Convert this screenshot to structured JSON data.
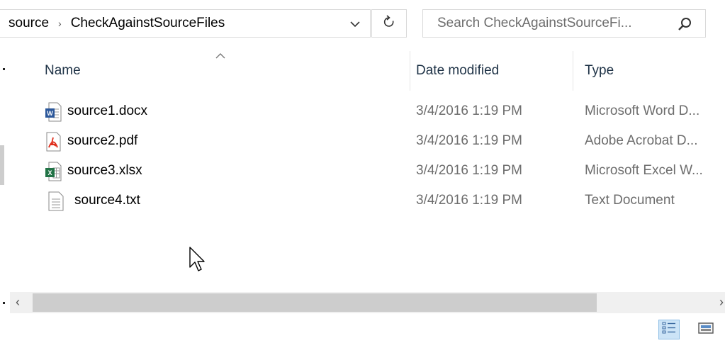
{
  "address_bar": {
    "crumbs": [
      "source",
      "CheckAgainstSourceFiles"
    ],
    "separator": "›",
    "dropdown_icon": "chevron-down-icon",
    "refresh_icon": "refresh-icon"
  },
  "search": {
    "placeholder": "Search CheckAgainstSourceFi...",
    "icon": "search-icon"
  },
  "columns": [
    {
      "label": "Name",
      "sorted": "ascending"
    },
    {
      "label": "Date modified"
    },
    {
      "label": "Type"
    }
  ],
  "files": [
    {
      "name": "source1.docx",
      "date": "3/4/2016 1:19 PM",
      "type": "Microsoft Word D...",
      "icon": "word-document-icon"
    },
    {
      "name": "source2.pdf",
      "date": "3/4/2016 1:19 PM",
      "type": "Adobe Acrobat D...",
      "icon": "pdf-document-icon"
    },
    {
      "name": "source3.xlsx",
      "date": "3/4/2016 1:19 PM",
      "type": "Microsoft Excel W...",
      "icon": "excel-document-icon"
    },
    {
      "name": "source4.txt",
      "date": "3/4/2016 1:19 PM",
      "type": "Text Document",
      "icon": "text-document-icon"
    }
  ],
  "scrollbar": {
    "left_arrow": "‹",
    "right_arrow": "›"
  },
  "view_modes": [
    {
      "icon": "details-view-icon",
      "active": true
    },
    {
      "icon": "large-icons-view-icon",
      "active": false
    }
  ],
  "colors": {
    "header_text": "#1e3246",
    "secondary_text": "#6d6d6d",
    "border": "#d9d9d9",
    "scroll_thumb": "#cdcdcd",
    "active_view_bg": "#cce4f7"
  }
}
